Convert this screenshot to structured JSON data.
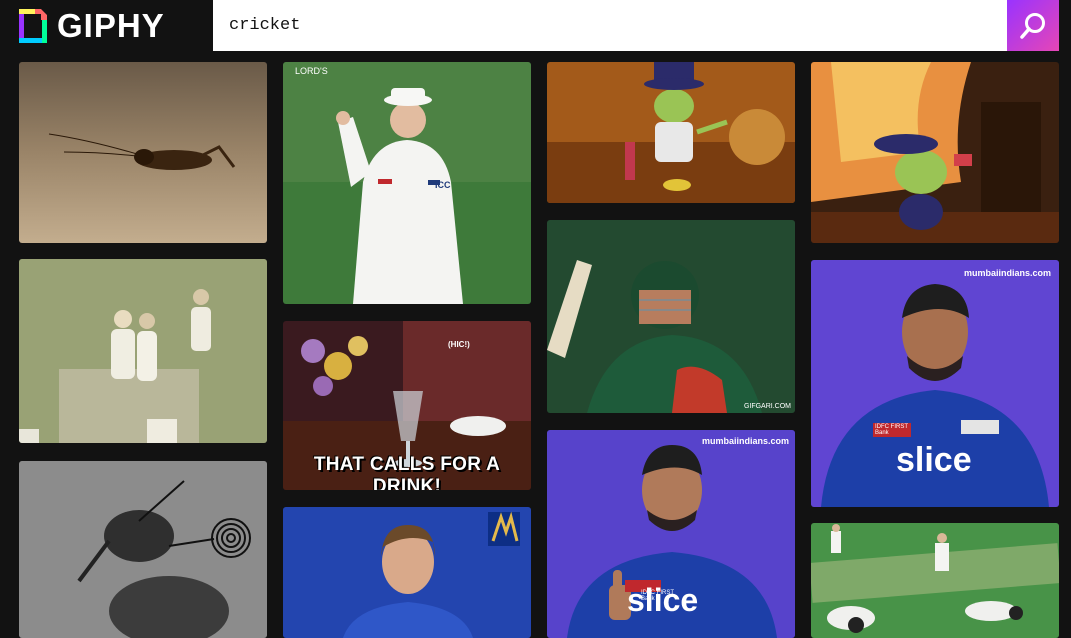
{
  "header": {
    "logo_text": "GIPHY",
    "search": {
      "value": "cricket"
    },
    "search_icon": "search-icon"
  },
  "results": {
    "t1_lords_watermark": "LORD'S",
    "t1_icc_text": "ICC",
    "drink_caption": "THAT CALLS FOR A DRINK!",
    "drink_tag": "(HIC!)",
    "gifgari_watermark": "GIFGARI.COM",
    "mi_watermark_1": "mumbaiindians.com",
    "mi_watermark_2": "mumbaiindians.com",
    "sponsor_1": "slice",
    "sponsor_2": "slice",
    "bank_1": "IDFC FIRST Bank",
    "bank_2": "IDFC FIRST Bank"
  }
}
